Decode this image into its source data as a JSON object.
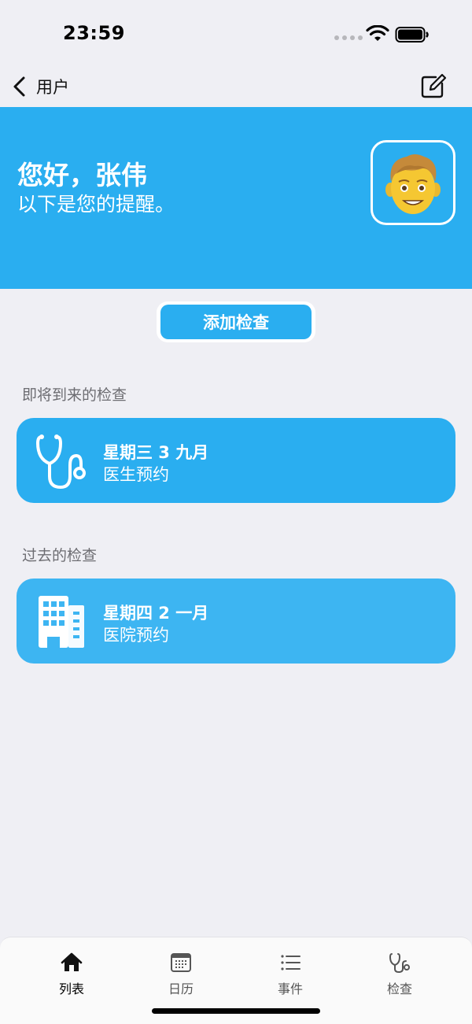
{
  "status_bar": {
    "time": "23:59"
  },
  "nav": {
    "back_label": "用户"
  },
  "header": {
    "greeting": "您好，张伟",
    "subtitle": "以下是您的提醒。",
    "background_color": "#2aaef0"
  },
  "actions": {
    "add_label": "添加检查"
  },
  "upcoming": {
    "title": "即将到来的检查",
    "items": [
      {
        "date": "星期三 3 九月",
        "type": "医生预约",
        "icon": "stethoscope-icon"
      }
    ]
  },
  "past": {
    "title": "过去的检查",
    "items": [
      {
        "date": "星期四 2 一月",
        "type": "医院预约",
        "icon": "hospital-building-icon"
      }
    ]
  },
  "tab_bar": {
    "tabs": [
      {
        "label": "列表",
        "icon": "home-icon",
        "active": true
      },
      {
        "label": "日历",
        "icon": "calendar-icon",
        "active": false
      },
      {
        "label": "事件",
        "icon": "list-icon",
        "active": false
      },
      {
        "label": "检查",
        "icon": "stethoscope-icon",
        "active": false
      }
    ]
  },
  "colors": {
    "accent": "#2aaef0",
    "background": "#efeff4",
    "section_title": "#6d6d72"
  }
}
